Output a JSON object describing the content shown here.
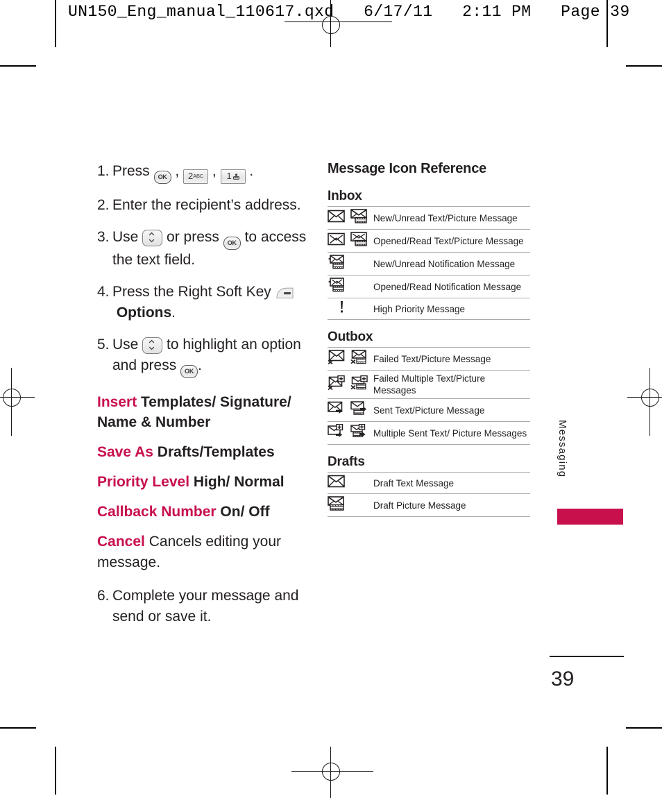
{
  "print_slug": "UN150_Eng_manual_110617.qxd   6/17/11   2:11 PM   Page 39",
  "steps": [
    {
      "num": "1.",
      "prefix": "Press",
      "keys": [
        "ok-key",
        "2abc-key",
        "1-voicemail-key"
      ],
      "suffix": ".",
      "text_plain": "Press  ,  ,  ."
    },
    {
      "num": "2.",
      "text_plain": "Enter the recipient’s address."
    },
    {
      "num": "3.",
      "text_plain": "Use  or press  to access the text field.",
      "part1": "Use",
      "part2": "or press",
      "part3": "to access the text field."
    },
    {
      "num": "4.",
      "part1": "Press the Right Soft Key",
      "bold_word": "Options",
      "suffix": ".",
      "text_plain": "Press the Right Soft Key  Options."
    },
    {
      "num": "5.",
      "part1": "Use",
      "part2": "to highlight an option and press",
      "suffix": ".",
      "text_plain": "Use  to highlight an option and press  ."
    },
    {
      "num": "6.",
      "text_plain": "Complete your message and send or save it."
    }
  ],
  "options": [
    {
      "term": "Insert",
      "def": "Templates/ Signature/ Name & Number"
    },
    {
      "term": "Save As",
      "def": "Drafts/Templates"
    },
    {
      "term": "Priority Level",
      "def": "High/ Normal"
    },
    {
      "term": "Callback Number",
      "def": "On/ Off"
    }
  ],
  "cancel": {
    "term": "Cancel",
    "def": "Cancels editing your message."
  },
  "reference": {
    "title": "Message Icon Reference",
    "groups": [
      {
        "name": "Inbox",
        "rows": [
          {
            "icons": [
              "envelope-new",
              "picture-msg-new"
            ],
            "label": "New/Unread Text/Picture Message"
          },
          {
            "icons": [
              "envelope-open",
              "picture-msg-open"
            ],
            "label": "Opened/Read Text/Picture Message"
          },
          {
            "icons": [
              "notification-new"
            ],
            "label": "New/Unread Notification Message"
          },
          {
            "icons": [
              "notification-open"
            ],
            "label": "Opened/Read Notification Message"
          },
          {
            "icons": [
              "exclamation"
            ],
            "label": "High Priority Message"
          }
        ]
      },
      {
        "name": "Outbox",
        "rows": [
          {
            "icons": [
              "envelope-failed",
              "picture-msg-failed"
            ],
            "label": "Failed Text/Picture Message"
          },
          {
            "icons": [
              "envelope-failed-multi",
              "picture-msg-failed-multi"
            ],
            "label": "Failed Multiple Text/Picture Messages"
          },
          {
            "icons": [
              "envelope-sent",
              "picture-msg-sent"
            ],
            "label": "Sent Text/Picture Message"
          },
          {
            "icons": [
              "envelope-sent-multi",
              "picture-msg-sent-multi"
            ],
            "label": "Multiple Sent Text/ Picture Messages"
          }
        ]
      },
      {
        "name": "Drafts",
        "rows": [
          {
            "icons": [
              "envelope-draft"
            ],
            "label": "Draft Text Message"
          },
          {
            "icons": [
              "picture-msg-draft"
            ],
            "label": "Draft Picture Message"
          }
        ]
      }
    ]
  },
  "side_tab": {
    "label": "Messaging",
    "bar_color": "#c8104c"
  },
  "folio": {
    "page_number": "39"
  },
  "keys": {
    "ok_label": "OK",
    "two_digit": "2",
    "two_letters": "ABC",
    "one_digit": "1"
  }
}
